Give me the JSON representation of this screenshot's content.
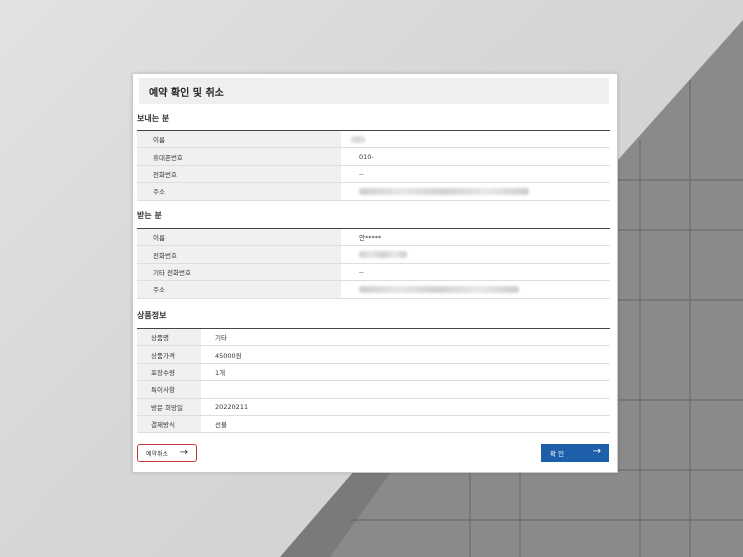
{
  "dialog": {
    "title": "예약 확인 및 취소"
  },
  "sender": {
    "section_title": "보내는 분",
    "rows": [
      {
        "label": "이름",
        "value": ""
      },
      {
        "label": "휴대폰번호",
        "value": "010-"
      },
      {
        "label": "전화번호",
        "value": "--"
      },
      {
        "label": "주소",
        "value": ""
      }
    ]
  },
  "receiver": {
    "section_title": "받는 분",
    "rows": [
      {
        "label": "이름",
        "value": "안*****"
      },
      {
        "label": "전화번호",
        "value": ""
      },
      {
        "label": "기타 전화번호",
        "value": "--"
      },
      {
        "label": "주소",
        "value": ""
      }
    ]
  },
  "product": {
    "section_title": "상품정보",
    "rows": [
      {
        "label": "상품명",
        "value": "기타"
      },
      {
        "label": "상품가격",
        "value": "45000원"
      },
      {
        "label": "포장수량",
        "value": "1개"
      },
      {
        "label": "특이사항",
        "value": ""
      },
      {
        "label": "방문 희망일",
        "value": "20220211"
      },
      {
        "label": "결제방식",
        "value": "선불"
      }
    ]
  },
  "buttons": {
    "cancel_label": "예약취소",
    "confirm_label": "확 인",
    "arrow": "→"
  },
  "colors": {
    "confirm_bg": "#1d5fa8",
    "cancel_border": "#c23a3a",
    "price_text": "#2a64a8"
  }
}
